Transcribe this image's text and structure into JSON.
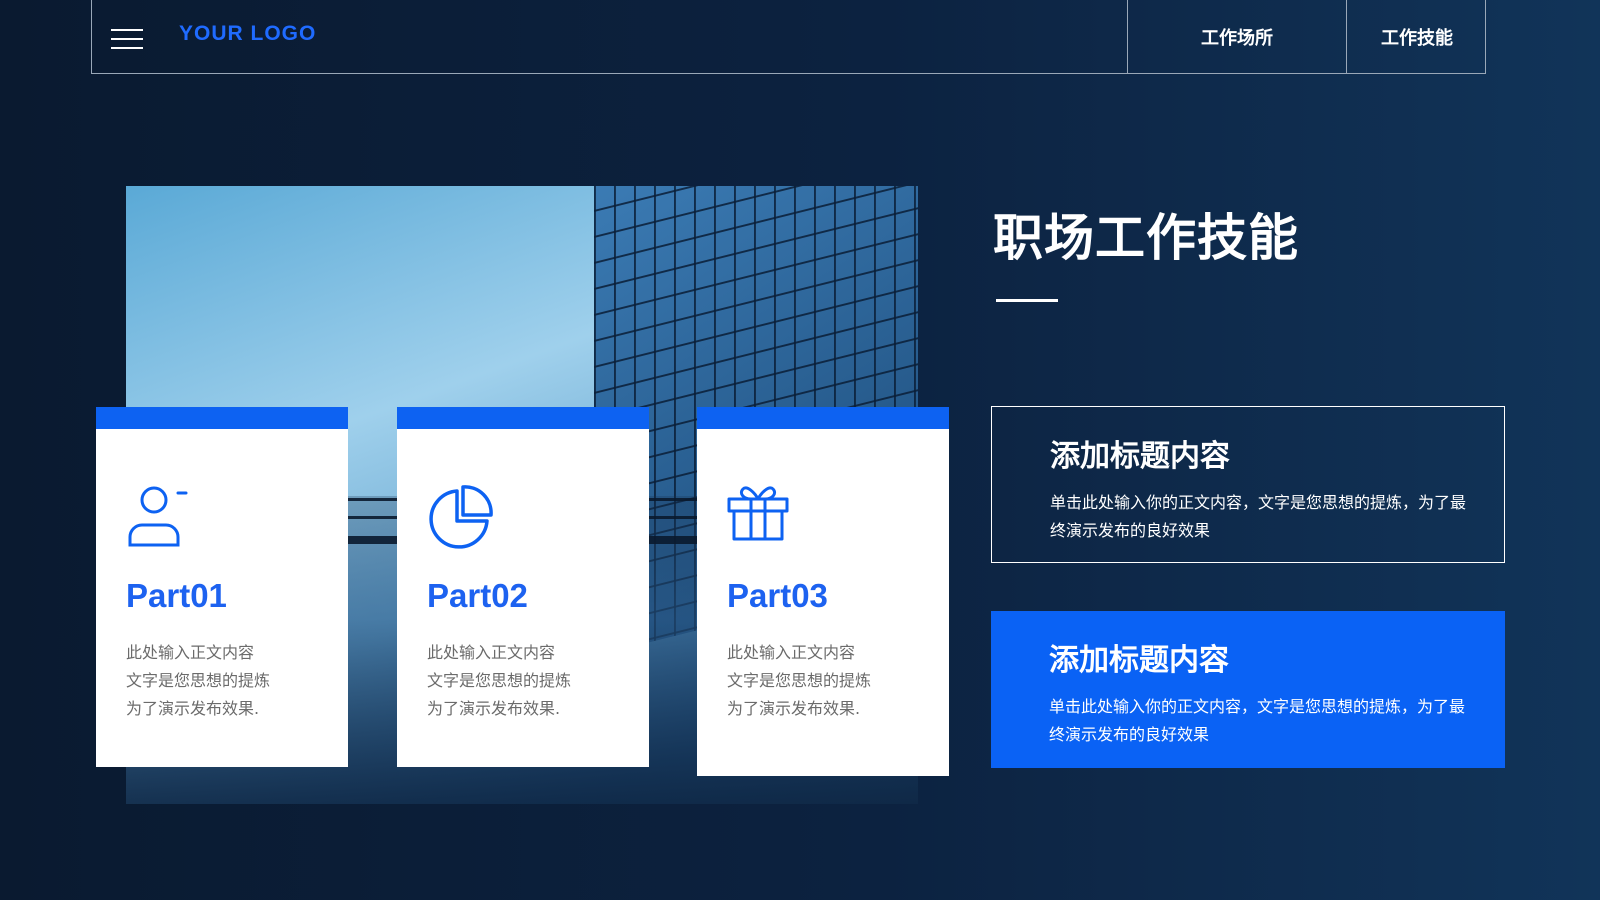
{
  "header": {
    "logo": "YOUR  LOGO",
    "nav": [
      "工作场所",
      "工作技能"
    ]
  },
  "cards": [
    {
      "icon": "user-icon",
      "title": "Part01",
      "lines": [
        "此处输入正文内容",
        "文字是您思想的提炼",
        "为了演示发布效果."
      ]
    },
    {
      "icon": "pie-chart-icon",
      "title": "Part02",
      "lines": [
        "此处输入正文内容",
        "文字是您思想的提炼",
        "为了演示发布效果."
      ]
    },
    {
      "icon": "gift-icon",
      "title": "Part03",
      "lines": [
        "此处输入正文内容",
        "文字是您思想的提炼",
        "为了演示发布效果."
      ]
    }
  ],
  "main": {
    "title": "职场工作技能",
    "boxes": [
      {
        "title": "添加标题内容",
        "text": "单击此处输入你的正文内容，文字是您思想的提炼，为了最终演示发布的良好效果"
      },
      {
        "title": "添加标题内容",
        "text": "单击此处输入你的正文内容，文字是您思想的提炼，为了最终演示发布的良好效果"
      }
    ]
  },
  "colors": {
    "accent": "#0d62f2",
    "background": "#0c2240",
    "card_text": "#6b6b6b"
  }
}
